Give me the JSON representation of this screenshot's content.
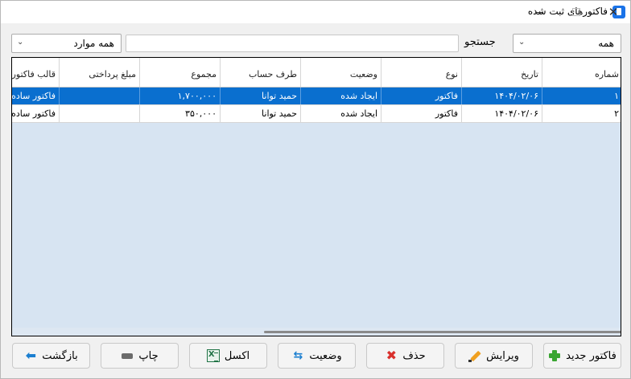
{
  "window": {
    "title": "فاکتورهای ثبت شده",
    "controls": {
      "minimize": "—",
      "maximize": "☐",
      "close": "✕"
    }
  },
  "filters": {
    "scope_combo": {
      "value": "همه",
      "arrow": "⌄"
    },
    "search_label": "جستجو",
    "search_value": "",
    "status_combo": {
      "value": "همه موارد",
      "arrow": "⌄"
    }
  },
  "grid": {
    "columns": [
      "شماره",
      "تاریخ",
      "نوع",
      "وضعیت",
      "طرف حساب",
      "مجموع",
      "مبلغ پرداختی",
      "قالب فاکتور"
    ],
    "rows": [
      {
        "number": "۱",
        "date": "۱۴۰۴/۰۲/۰۶",
        "type": "فاکتور",
        "status": "ایجاد شده",
        "account": "حمید توانا",
        "total": "۱,۷۰۰,۰۰۰",
        "paid": "",
        "template": "فاکتور ساده",
        "selected": true
      },
      {
        "number": "۲",
        "date": "۱۴۰۴/۰۲/۰۶",
        "type": "فاکتور",
        "status": "ایجاد شده",
        "account": "حمید توانا",
        "total": "۳۵۰,۰۰۰",
        "paid": "",
        "template": "فاکتور ساده",
        "selected": false
      }
    ],
    "selection_color": "#0a6fcf",
    "background_color": "#d7e4f2"
  },
  "toolbar": {
    "new_label": "فاکتور جدید",
    "edit_label": "ویرایش",
    "delete_label": "حذف",
    "status_label": "وضعیت",
    "excel_label": "اکسل",
    "print_label": "چاپ",
    "back_label": "بازگشت",
    "icons": {
      "new": "plus-icon",
      "edit": "pencil-icon",
      "delete": "x-icon",
      "status": "swap-icon",
      "excel": "excel-icon",
      "print": "printer-icon",
      "back": "arrow-left-icon"
    },
    "delete_glyph": "✖",
    "status_glyph": "⇆",
    "back_glyph": "⬅"
  }
}
